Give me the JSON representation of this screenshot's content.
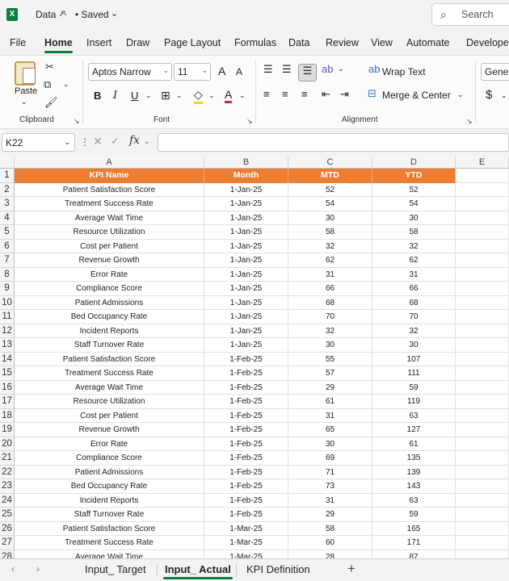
{
  "titlebar": {
    "app_badge": "X",
    "doc_title": "Data",
    "share_icon": "ዶ",
    "saved": "• Saved",
    "saved_chevron": "⌄",
    "search_icon": "⌕",
    "search_placeholder": "Search"
  },
  "ribbon_tabs": [
    "File",
    "Home",
    "Insert",
    "Draw",
    "Page Layout",
    "Formulas",
    "Data",
    "Review",
    "View",
    "Automate",
    "Develope"
  ],
  "active_tab": "Home",
  "ribbon": {
    "clipboard": {
      "label": "Clipboard",
      "paste": "Paste",
      "cut_icon": "✂",
      "copy_icon": "⧉",
      "format_painter_icon": "🖌",
      "launcher": "↘"
    },
    "font": {
      "label": "Font",
      "font_name": "Aptos Narrow",
      "font_size": "11",
      "grow": "A",
      "shrink": "A",
      "bold": "B",
      "italic": "I",
      "underline": "U",
      "borders_icon": "⊞",
      "fill_icon": "◇",
      "font_color": "A",
      "launcher": "↘"
    },
    "alignment": {
      "label": "Alignment",
      "wrap_text": "Wrap Text",
      "merge_center": "Merge & Center",
      "launcher": "↘"
    },
    "number": {
      "format": "Genera",
      "currency": "$"
    }
  },
  "formula_bar": {
    "name_box": "K22",
    "fx": "fx",
    "formula": ""
  },
  "sheet": {
    "columns": [
      "A",
      "B",
      "C",
      "D",
      "E"
    ],
    "header_color": "#ed7d31",
    "headers": [
      "KPI Name",
      "Month",
      "MTD",
      "YTD"
    ],
    "rows": [
      [
        "Patient Satisfaction Score",
        "1-Jan-25",
        "52",
        "52"
      ],
      [
        "Treatment Success Rate",
        "1-Jan-25",
        "54",
        "54"
      ],
      [
        "Average Wait Time",
        "1-Jan-25",
        "30",
        "30"
      ],
      [
        "Resource Utilization",
        "1-Jan-25",
        "58",
        "58"
      ],
      [
        "Cost per Patient",
        "1-Jan-25",
        "32",
        "32"
      ],
      [
        "Revenue Growth",
        "1-Jan-25",
        "62",
        "62"
      ],
      [
        "Error Rate",
        "1-Jan-25",
        "31",
        "31"
      ],
      [
        "Compliance Score",
        "1-Jan-25",
        "66",
        "66"
      ],
      [
        "Patient Admissions",
        "1-Jan-25",
        "68",
        "68"
      ],
      [
        "Bed Occupancy Rate",
        "1-Jan-25",
        "70",
        "70"
      ],
      [
        "Incident Reports",
        "1-Jan-25",
        "32",
        "32"
      ],
      [
        "Staff Turnover Rate",
        "1-Jan-25",
        "30",
        "30"
      ],
      [
        "Patient Satisfaction Score",
        "1-Feb-25",
        "55",
        "107"
      ],
      [
        "Treatment Success Rate",
        "1-Feb-25",
        "57",
        "111"
      ],
      [
        "Average Wait Time",
        "1-Feb-25",
        "29",
        "59"
      ],
      [
        "Resource Utilization",
        "1-Feb-25",
        "61",
        "119"
      ],
      [
        "Cost per Patient",
        "1-Feb-25",
        "31",
        "63"
      ],
      [
        "Revenue Growth",
        "1-Feb-25",
        "65",
        "127"
      ],
      [
        "Error Rate",
        "1-Feb-25",
        "30",
        "61"
      ],
      [
        "Compliance Score",
        "1-Feb-25",
        "69",
        "135"
      ],
      [
        "Patient Admissions",
        "1-Feb-25",
        "71",
        "139"
      ],
      [
        "Bed Occupancy Rate",
        "1-Feb-25",
        "73",
        "143"
      ],
      [
        "Incident Reports",
        "1-Feb-25",
        "31",
        "63"
      ],
      [
        "Staff Turnover Rate",
        "1-Feb-25",
        "29",
        "59"
      ],
      [
        "Patient Satisfaction Score",
        "1-Mar-25",
        "58",
        "165"
      ],
      [
        "Treatment Success Rate",
        "1-Mar-25",
        "60",
        "171"
      ],
      [
        "Average Wait Time",
        "1-Mar-25",
        "28",
        "87"
      ]
    ]
  },
  "sheet_tabs": [
    "Input_ Target",
    "Input_ Actual",
    "KPI Definition"
  ],
  "active_sheet": "Input_ Actual",
  "add_sheet": "+"
}
